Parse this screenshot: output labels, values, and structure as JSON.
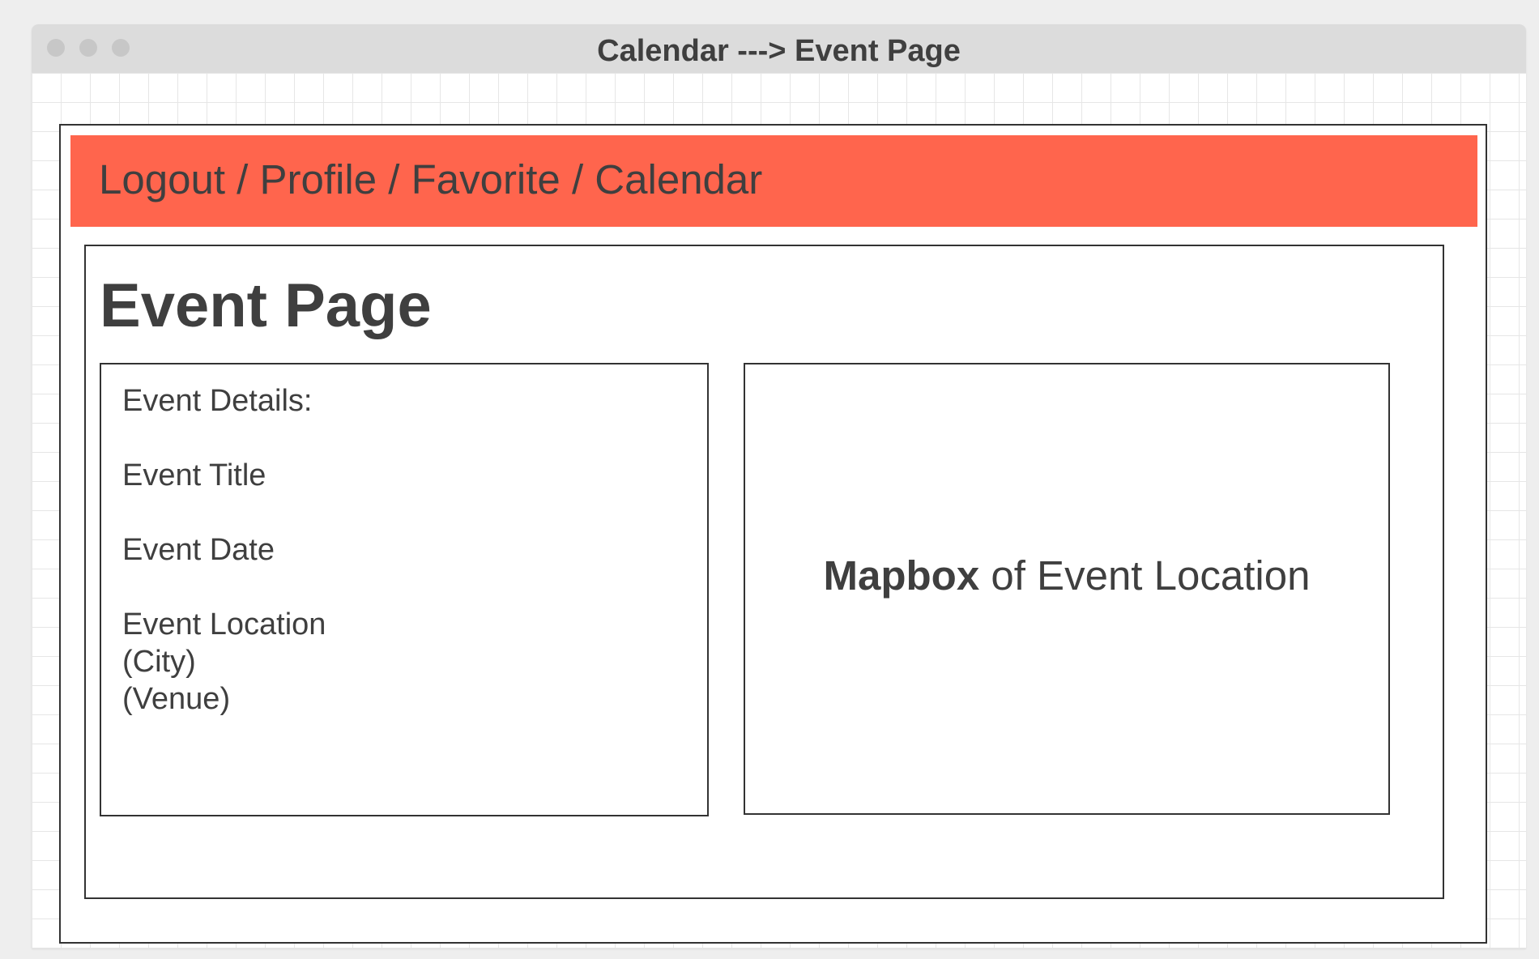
{
  "window": {
    "title": "Calendar ---> Event Page",
    "controls": [
      "close-dot",
      "minimize-dot",
      "maximize-dot"
    ]
  },
  "navbar": {
    "text": "Logout / Profile / Favorite / Calendar",
    "background_color": "#ff654d"
  },
  "page": {
    "title": "Event Page"
  },
  "details": {
    "heading": "Event Details:",
    "title": "Event Title",
    "date": "Event Date",
    "location": "Event Location",
    "city": "(City)",
    "venue": "(Venue)"
  },
  "map": {
    "label_bold": "Mapbox",
    "label_rest": " of Event Location"
  }
}
